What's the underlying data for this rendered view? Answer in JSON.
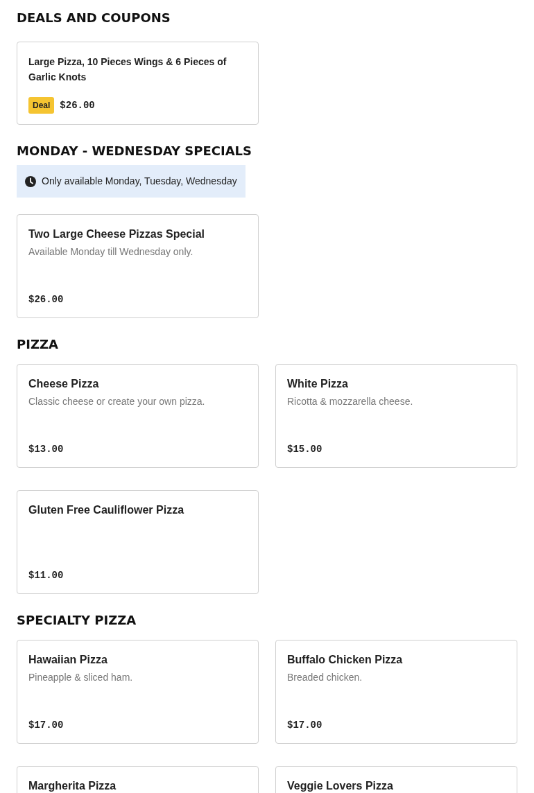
{
  "sections": [
    {
      "title": "DEALS AND COUPONS",
      "items": [
        {
          "kind": "deal",
          "name": "Large Pizza, 10 Pieces Wings & 6 Pieces of Garlic Knots",
          "badge": "Deal",
          "price": "$26.00"
        }
      ]
    },
    {
      "title": "MONDAY - WEDNESDAY SPECIALS",
      "notice": "Only available Monday, Tuesday, Wednesday",
      "items": [
        {
          "kind": "item",
          "name": "Two Large Cheese Pizzas Special",
          "description": "Available Monday till Wednesday only.",
          "price": "$26.00"
        }
      ]
    },
    {
      "title": "PIZZA",
      "items": [
        {
          "kind": "item",
          "name": "Cheese Pizza",
          "description": "Classic cheese or create your own pizza.",
          "price": "$13.00"
        },
        {
          "kind": "item",
          "name": "White Pizza",
          "description": "Ricotta & mozzarella cheese.",
          "price": "$15.00"
        },
        {
          "kind": "item",
          "name": "Gluten Free Cauliflower Pizza",
          "price": "$11.00"
        }
      ]
    },
    {
      "title": "SPECIALTY PIZZA",
      "items": [
        {
          "kind": "item",
          "name": "Hawaiian Pizza",
          "description": "Pineapple & sliced ham.",
          "price": "$17.00"
        },
        {
          "kind": "item",
          "name": "Buffalo Chicken Pizza",
          "description": "Breaded chicken.",
          "price": "$17.00"
        },
        {
          "kind": "item",
          "name": "Margherita Pizza"
        },
        {
          "kind": "item",
          "name": "Veggie Lovers Pizza"
        }
      ]
    }
  ]
}
